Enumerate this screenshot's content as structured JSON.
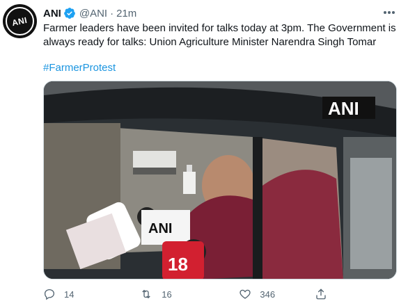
{
  "tweet": {
    "avatar_text": "ANI",
    "name": "ANI",
    "handle": "@ANI",
    "separator": "·",
    "time": "21m",
    "text": "Farmer leaders have been invited for talks today at 3pm. The Government is always ready for talks: Union Agriculture Minister Narendra Singh Tomar",
    "hashtag": "#FarmerProtest",
    "media": {
      "watermark": "ANI",
      "mic_labels": [
        "ANI",
        "18"
      ]
    },
    "stats": {
      "replies": "14",
      "retweets": "16",
      "likes": "346"
    }
  },
  "colors": {
    "link": "#1b95e0",
    "secondary_text": "#536471",
    "verified": "#1da1f2"
  },
  "icons": [
    "verified-badge-icon",
    "more-options-icon",
    "reply-icon",
    "retweet-icon",
    "like-icon",
    "share-icon"
  ]
}
